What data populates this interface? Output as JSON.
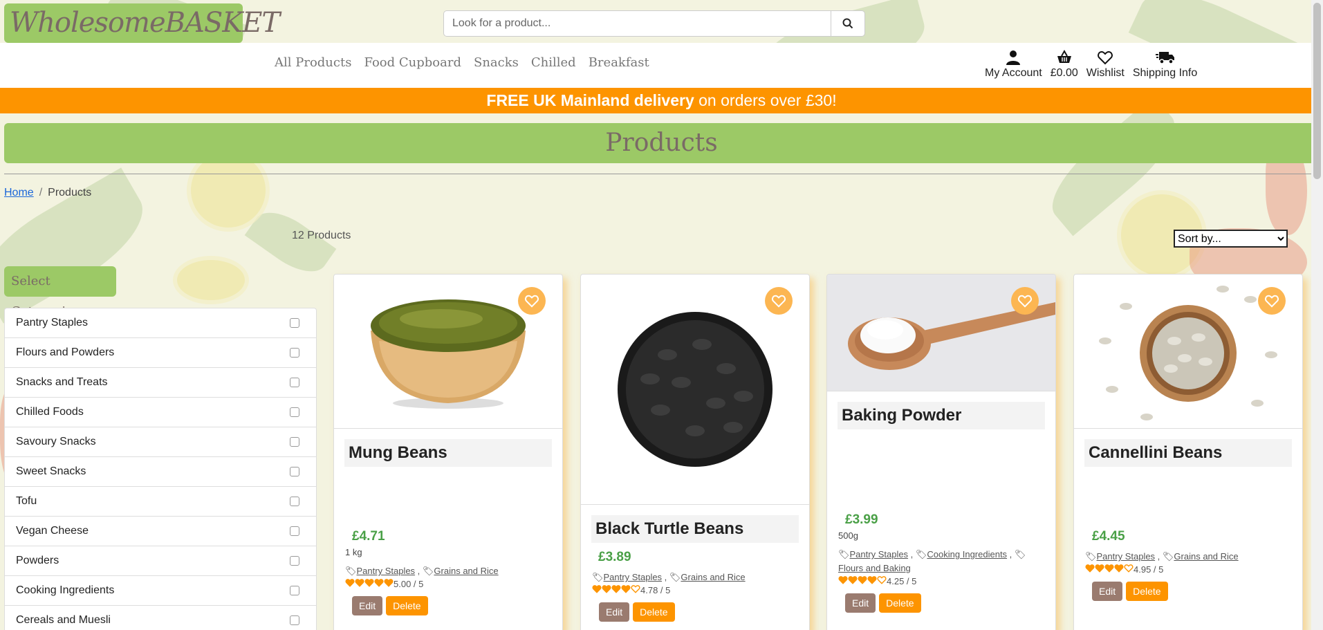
{
  "brand": "WholesomeBASKET",
  "search": {
    "placeholder": "Look for a product..."
  },
  "nav": {
    "links": [
      "All Products",
      "Food Cupboard",
      "Snacks",
      "Chilled",
      "Breakfast"
    ],
    "icons": [
      {
        "label": "My Account",
        "icon": "user-icon"
      },
      {
        "label": "£0.00",
        "icon": "basket-icon"
      },
      {
        "label": "Wishlist",
        "icon": "heart-icon"
      },
      {
        "label": "Shipping Info",
        "icon": "truck-icon"
      }
    ]
  },
  "banner": {
    "bold": "FREE UK Mainland delivery",
    "rest": " on orders over £30!"
  },
  "page_title": "Products",
  "breadcrumb": {
    "home": "Home",
    "current": "Products",
    "separator": "/"
  },
  "product_count": "12 Products",
  "sort": {
    "selected": "Sort by..."
  },
  "categories": {
    "label": "Select Categories:",
    "items": [
      "Pantry Staples",
      "Flours and Powders",
      "Snacks and Treats",
      "Chilled Foods",
      "Savoury Snacks",
      "Sweet Snacks",
      "Tofu",
      "Vegan Cheese",
      "Powders",
      "Cooking Ingredients",
      "Cereals and Muesli"
    ]
  },
  "products": [
    {
      "name": "Mung Beans",
      "price": "£4.71",
      "size": "1 kg",
      "tags": [
        "Pantry Staples",
        "Grains and Rice"
      ],
      "rating": "5.00 / 5",
      "stars": 5,
      "edit": "Edit",
      "delete": "Delete"
    },
    {
      "name": "Black Turtle Beans",
      "price": "£3.89",
      "size": "",
      "tags": [
        "Pantry Staples",
        "Grains and Rice"
      ],
      "rating": "4.78 / 5",
      "stars": 4,
      "edit": "Edit",
      "delete": "Delete"
    },
    {
      "name": "Baking Powder",
      "price": "£3.99",
      "size": "500g",
      "tags": [
        "Pantry Staples",
        "Cooking Ingredients",
        "Flours and Baking"
      ],
      "rating": "4.25 / 5",
      "stars": 4,
      "edit": "Edit",
      "delete": "Delete"
    },
    {
      "name": "Cannellini Beans",
      "price": "£4.45",
      "size": "",
      "tags": [
        "Pantry Staples",
        "Grains and Rice"
      ],
      "rating": "4.95 / 5",
      "stars": 4,
      "edit": "Edit",
      "delete": "Delete"
    }
  ],
  "colors": {
    "green": "#9cc966",
    "orange": "#fd9400",
    "brown": "#9a7b6f",
    "price_green": "#4aa047"
  }
}
